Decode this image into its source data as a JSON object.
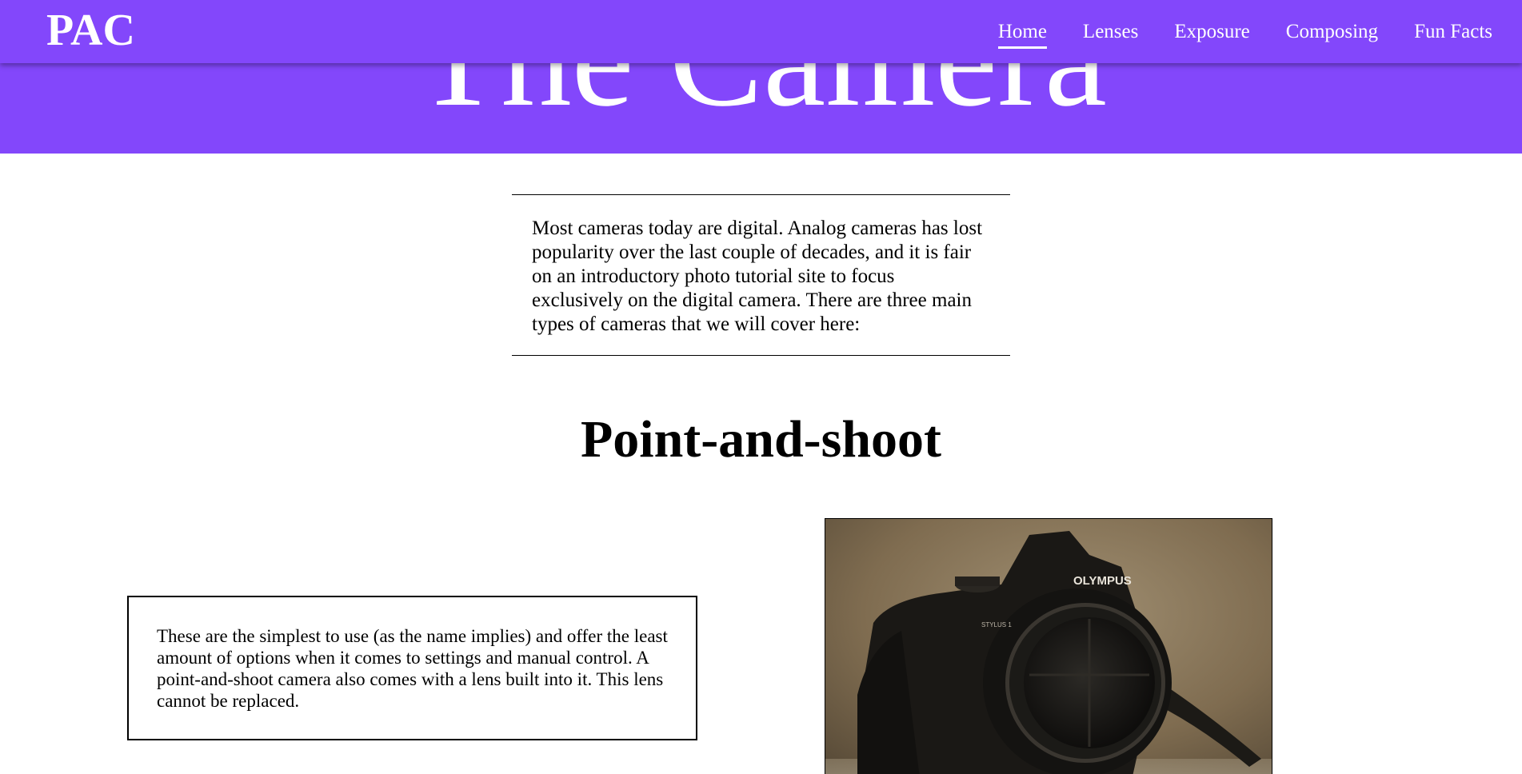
{
  "nav": {
    "logo": "PAC",
    "links": [
      {
        "label": "Home",
        "active": true
      },
      {
        "label": "Lenses",
        "active": false
      },
      {
        "label": "Exposure",
        "active": false
      },
      {
        "label": "Composing",
        "active": false
      },
      {
        "label": "Fun Facts",
        "active": false
      }
    ]
  },
  "hero": {
    "title": "The Camera"
  },
  "intro": {
    "text": "Most cameras today are digital. Analog cameras has lost popularity over the last couple of decades, and it is fair on an introductory photo tutorial site to focus exclusively on the digital camera. There are three main types of cameras that we will cover here:"
  },
  "section": {
    "heading": "Point-and-shoot",
    "description": "These are the simplest to use (as the name implies) and offer the least amount of options when it comes to settings and manual control. A point-and-shoot camera also comes with a lens built into it. This lens cannot be replaced.",
    "image": {
      "brand_text": "OLYMPUS",
      "model_text": "STYLUS 1"
    }
  },
  "colors": {
    "brand": "#8347fb",
    "text": "#000000",
    "background": "#ffffff"
  }
}
